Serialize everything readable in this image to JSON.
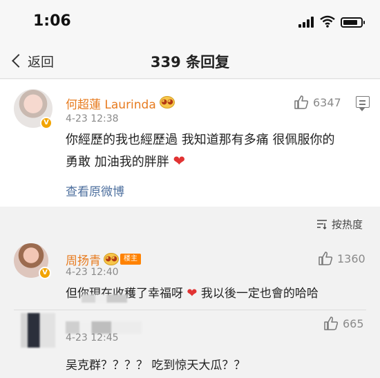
{
  "status": {
    "time": "1:06"
  },
  "nav": {
    "back_label": "返回",
    "title": "339 条回复"
  },
  "main_comment": {
    "author": "何超蓮 Laurinda",
    "timestamp": "4-23 12:38",
    "likes": "6347",
    "text_line1": "你經歷的我也經歷過 我知道那有多痛 很佩服你的",
    "text_line2": "勇敢 加油我的胖胖",
    "view_original": "查看原微博"
  },
  "sort": {
    "label": "按热度"
  },
  "replies": [
    {
      "author": "周扬青",
      "badge": "楼主",
      "timestamp": "4-23 12:40",
      "likes": "1360",
      "text_before_heart": "但你現在收穫了幸福呀",
      "text_after_heart": "我以後一定也會的哈哈"
    },
    {
      "timestamp": "4-23 12:45",
      "likes": "665",
      "text": "吴克群？？？？ 吃到惊天大瓜？？"
    }
  ],
  "icons": {
    "signal": "signal-icon",
    "wifi": "wifi-icon",
    "battery": "battery-icon",
    "thumb": "thumbs-up-icon",
    "comment": "comment-icon",
    "sort": "sort-icon",
    "heart": "heart-icon"
  },
  "colors": {
    "author": "#e77b1f",
    "link": "#4d6f9e",
    "heart": "#e13333",
    "host_tag": "#ff8200"
  }
}
